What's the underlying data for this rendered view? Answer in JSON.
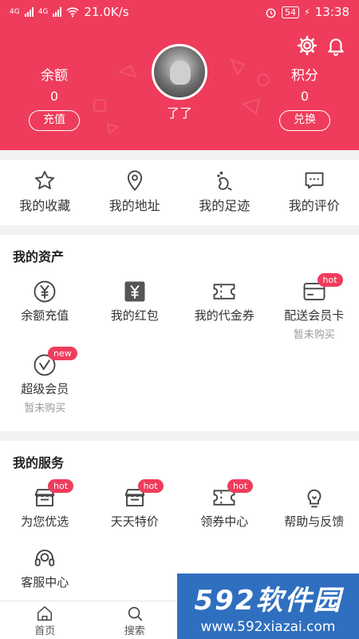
{
  "status_bar": {
    "network": "21.0K/s",
    "battery": "54",
    "time": "13:38",
    "signal_label": "4G"
  },
  "profile": {
    "balance_label": "余额",
    "balance_value": "0",
    "recharge_button": "充值",
    "username": "了了",
    "points_label": "积分",
    "points_value": "0",
    "exchange_button": "兑换"
  },
  "quick_links": [
    {
      "label": "我的收藏",
      "icon": "star-icon"
    },
    {
      "label": "我的地址",
      "icon": "location-icon"
    },
    {
      "label": "我的足迹",
      "icon": "footprint-icon"
    },
    {
      "label": "我的评价",
      "icon": "comment-icon"
    }
  ],
  "assets": {
    "title": "我的资产",
    "items": [
      {
        "label": "余额充值",
        "sub": "",
        "badge": "",
        "icon": "yen-circle-icon"
      },
      {
        "label": "我的红包",
        "sub": "",
        "badge": "",
        "icon": "red-packet-icon"
      },
      {
        "label": "我的代金券",
        "sub": "",
        "badge": "",
        "icon": "coupon-icon"
      },
      {
        "label": "配送会员卡",
        "sub": "暂未购买",
        "badge": "hot",
        "icon": "card-icon"
      },
      {
        "label": "超级会员",
        "sub": "暂未购买",
        "badge": "new",
        "icon": "vip-icon"
      }
    ]
  },
  "services": {
    "title": "我的服务",
    "items": [
      {
        "label": "为您优选",
        "badge": "hot",
        "icon": "shop-icon"
      },
      {
        "label": "天天特价",
        "badge": "hot",
        "icon": "shop-icon"
      },
      {
        "label": "领券中心",
        "badge": "hot",
        "icon": "coupon-icon"
      },
      {
        "label": "帮助与反馈",
        "badge": "",
        "icon": "bulb-icon"
      },
      {
        "label": "客服中心",
        "badge": "",
        "icon": "headset-icon"
      }
    ]
  },
  "tabbar": [
    {
      "label": "首页",
      "icon": "home-icon"
    },
    {
      "label": "搜索",
      "icon": "search-icon"
    }
  ],
  "watermark": {
    "brand": "592软件园",
    "url": "www.592xiazai.com"
  },
  "colors": {
    "accent": "#ef3c5c",
    "badge": "#ef3c5c",
    "watermark": "#2f6fbf"
  }
}
